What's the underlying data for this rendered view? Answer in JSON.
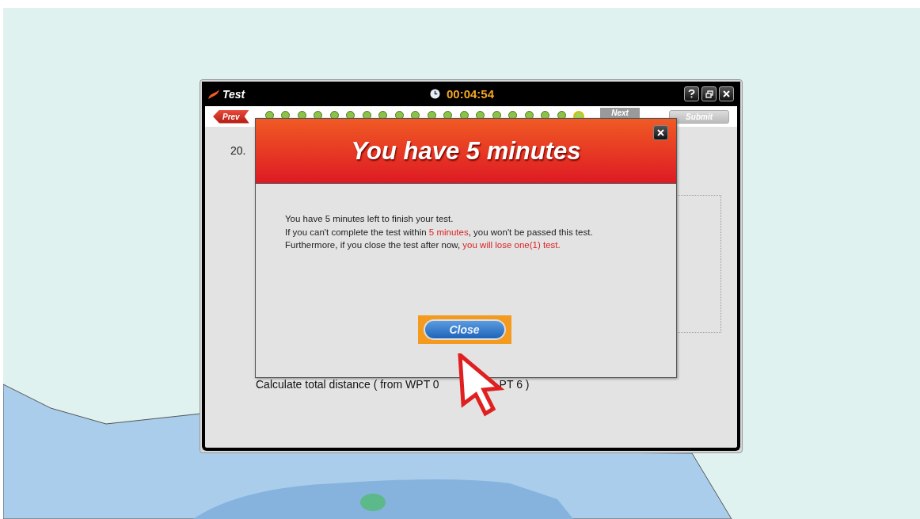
{
  "window": {
    "title": "Test",
    "timer": "00:04:54"
  },
  "navigation": {
    "prev": "Prev",
    "next": {
      "label": "Next",
      "disabled": true
    },
    "submit": "Submit"
  },
  "progress": [
    {
      "selected": false
    },
    {
      "selected": false
    },
    {
      "selected": false
    },
    {
      "selected": false
    },
    {
      "selected": false
    },
    {
      "selected": false
    },
    {
      "selected": false
    },
    {
      "selected": false
    },
    {
      "selected": false
    },
    {
      "selected": false
    },
    {
      "selected": false
    },
    {
      "selected": false
    },
    {
      "selected": false
    },
    {
      "selected": false
    },
    {
      "selected": false
    },
    {
      "selected": false
    },
    {
      "selected": false
    },
    {
      "selected": false
    },
    {
      "selected": false
    },
    {
      "selected": true
    }
  ],
  "question": {
    "number": "20.",
    "text_parts": [
      "Calculate total distance ( from WPT 0",
      "PT 6 )"
    ]
  },
  "dialog": {
    "title": "You have 5 minutes",
    "lines": [
      [
        {
          "text": "You have 5 minutes left to finish your test.",
          "highlight": false
        }
      ],
      [
        {
          "text": "If you can't complete the test within ",
          "highlight": false
        },
        {
          "text": "5 minutes",
          "highlight": true
        },
        {
          "text": ", you won't be passed this test.",
          "highlight": false
        }
      ],
      [
        {
          "text": "Furthermore, if you close the test after now, ",
          "highlight": false
        },
        {
          "text": "you will lose one(1) test.",
          "highlight": true
        }
      ]
    ],
    "button": "Close"
  }
}
